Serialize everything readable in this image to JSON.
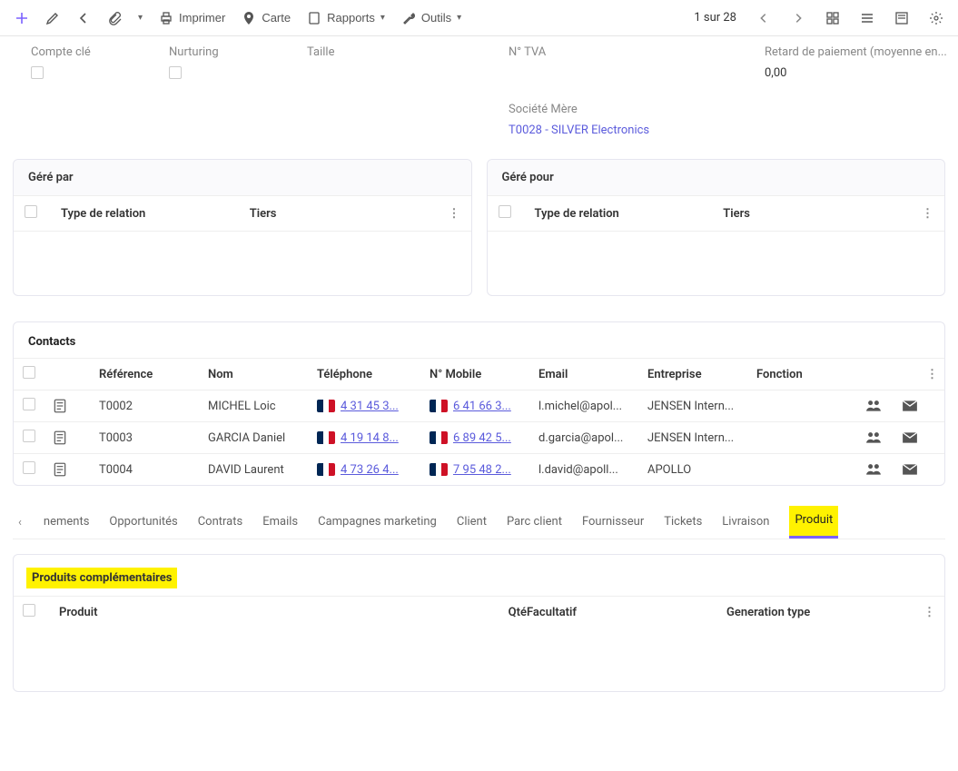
{
  "toolbar": {
    "print": "Imprimer",
    "map": "Carte",
    "reports": "Rapports",
    "tools": "Outils",
    "pager": "1 sur 28"
  },
  "fields": {
    "compteCleLabel": "Compte clé",
    "nurturingLabel": "Nurturing",
    "tailleLabel": "Taille",
    "tvaLabel": "N° TVA",
    "retardLabel": "Retard de paiement (moyenne en...",
    "retardValue": "0,00",
    "societeMereLabel": "Société Mère",
    "societeMereValue": "T0028 - SILVER Electronics"
  },
  "managedBy": {
    "title": "Géré par",
    "col1": "Type de relation",
    "col2": "Tiers"
  },
  "managedFor": {
    "title": "Géré pour",
    "col1": "Type de relation",
    "col2": "Tiers"
  },
  "contacts": {
    "title": "Contacts",
    "headers": {
      "ref": "Référence",
      "name": "Nom",
      "phone": "Téléphone",
      "mobile": "N° Mobile",
      "email": "Email",
      "company": "Entreprise",
      "function": "Fonction"
    },
    "rows": [
      {
        "ref": "T0002",
        "name": "MICHEL Loic",
        "phone": "4 31 45 3...",
        "mobile": "6 41 66 3...",
        "email": "l.michel@apol...",
        "company": "JENSEN Intern..."
      },
      {
        "ref": "T0003",
        "name": "GARCIA Daniel",
        "phone": "4 19 14 8...",
        "mobile": "6 89 42 5...",
        "email": "d.garcia@apol...",
        "company": "JENSEN Intern..."
      },
      {
        "ref": "T0004",
        "name": "DAVID Laurent",
        "phone": "4 73 26 4...",
        "mobile": "7 95 48 2...",
        "email": "l.david@apoll...",
        "company": "APOLLO"
      }
    ]
  },
  "tabs": {
    "t0": "nements",
    "t1": "Opportunités",
    "t2": "Contrats",
    "t3": "Emails",
    "t4": "Campagnes marketing",
    "t5": "Client",
    "t6": "Parc client",
    "t7": "Fournisseur",
    "t8": "Tickets",
    "t9": "Livraison",
    "t10": "Produit"
  },
  "subpanel": {
    "title": "Produits complémentaires",
    "colProduit": "Produit",
    "colQte": "Qté",
    "colFacultatif": "Facultatif",
    "colGen": "Generation type"
  }
}
